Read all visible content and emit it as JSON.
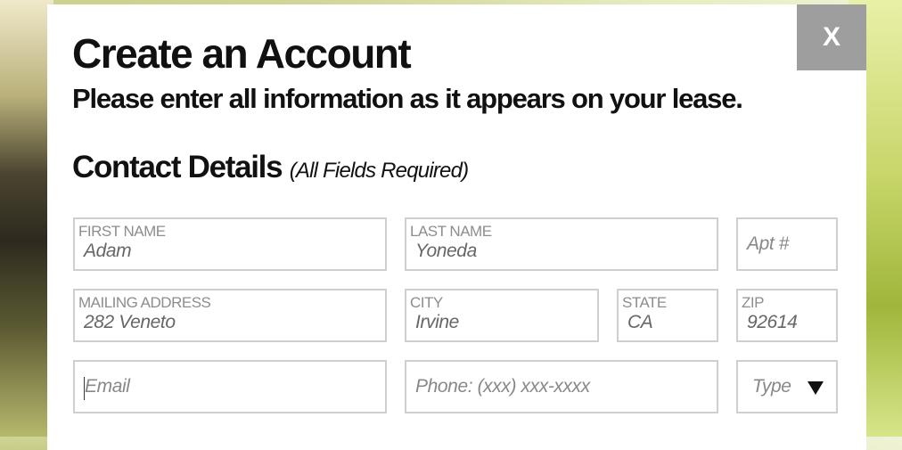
{
  "modal": {
    "close_label": "X",
    "title": "Create an Account",
    "subtitle": "Please enter all information as it appears on your lease.",
    "section_title": "Contact Details",
    "section_note": "(All Fields Required)"
  },
  "form": {
    "first_name": {
      "label": "FIRST NAME",
      "value": "Adam"
    },
    "last_name": {
      "label": "LAST NAME",
      "value": "Yoneda"
    },
    "apt": {
      "placeholder": "Apt #"
    },
    "mailing_address": {
      "label": "MAILING ADDRESS",
      "value": "282 Veneto"
    },
    "city": {
      "label": "CITY",
      "value": "Irvine"
    },
    "state": {
      "label": "STATE",
      "value": "CA"
    },
    "zip": {
      "label": "ZIP",
      "value": "92614"
    },
    "email": {
      "placeholder": "Email"
    },
    "phone": {
      "placeholder": "Phone: (xxx) xxx-xxxx"
    },
    "type": {
      "selected": "Type"
    }
  }
}
